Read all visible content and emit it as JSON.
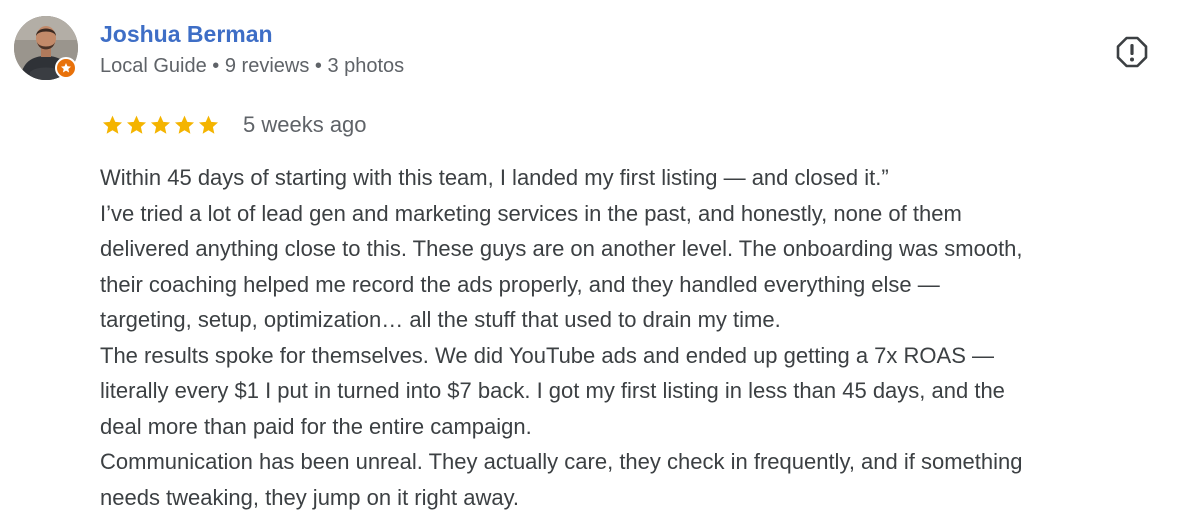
{
  "reviewer": {
    "name": "Joshua Berman",
    "meta": "Local Guide • 9 reviews • 3 photos",
    "avatar_icon": "profile-photo",
    "badge_icon": "local-guide-star-icon",
    "badge_color": "#e8710a"
  },
  "rating": {
    "stars": 5,
    "max_stars": 5,
    "star_color": "#f4b400",
    "date": "5 weeks ago"
  },
  "actions": {
    "flag_icon": "flag-report-icon"
  },
  "review": {
    "lines": [
      "Within 45 days of starting with this team, I landed my first listing — and closed it.”",
      "I’ve tried a lot of lead gen and marketing services in the past, and honestly, none of them",
      "delivered anything close to this. These guys are on another level. The onboarding was smooth,",
      "their coaching helped me record the ads properly, and they handled everything else —",
      "targeting, setup, optimization… all the stuff that used to drain my time.",
      "The results spoke for themselves. We did YouTube ads and ended up getting a 7x ROAS —",
      "literally every $1 I put in turned into $7 back. I got my first listing in less than 45 days, and the",
      "deal more than paid for the entire campaign.",
      "Communication has been unreal. They actually care, they check in frequently, and if something",
      "needs tweaking, they jump on it right away."
    ]
  }
}
